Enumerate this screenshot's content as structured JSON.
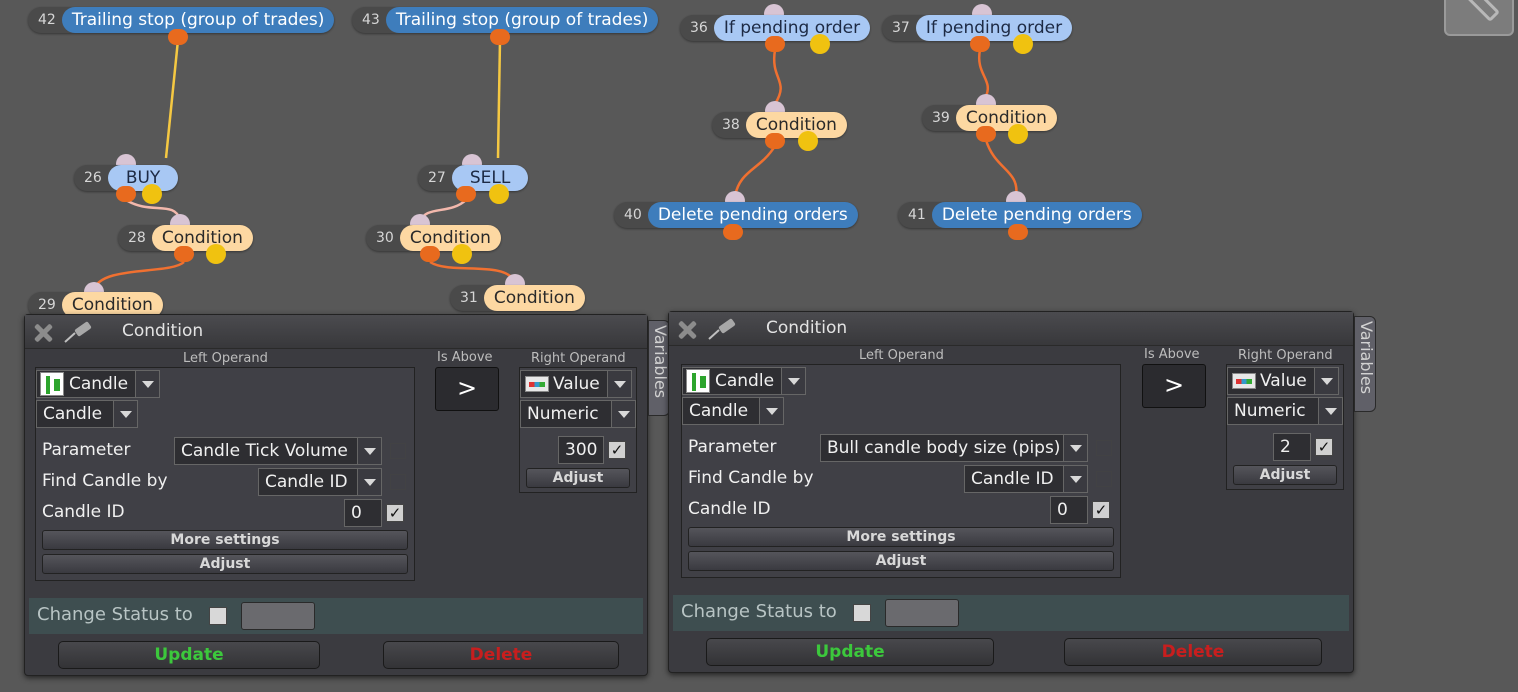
{
  "nodes": [
    {
      "id": "42",
      "label": "Trailing stop (group of trades)"
    },
    {
      "id": "43",
      "label": "Trailing stop (group of trades)"
    },
    {
      "id": "36",
      "label": "If pending order"
    },
    {
      "id": "37",
      "label": "If pending order"
    },
    {
      "id": "38",
      "label": "Condition"
    },
    {
      "id": "39",
      "label": "Condition"
    },
    {
      "id": "26",
      "label": "BUY"
    },
    {
      "id": "27",
      "label": "SELL"
    },
    {
      "id": "40",
      "label": "Delete pending orders"
    },
    {
      "id": "41",
      "label": "Delete pending orders"
    },
    {
      "id": "28",
      "label": "Condition"
    },
    {
      "id": "30",
      "label": "Condition"
    },
    {
      "id": "31",
      "label": "Condition"
    },
    {
      "id": "29",
      "label": "Condition"
    }
  ],
  "panels": [
    {
      "title": "Condition",
      "variables_tab": "Variables",
      "left_operand_label": "Left Operand",
      "is_above_label": "Is Above",
      "right_operand_label": "Right Operand",
      "left_type": "Candle",
      "left_subtype": "Candle",
      "parameter_label": "Parameter",
      "parameter_value": "Candle Tick Volume",
      "find_by_label": "Find Candle by",
      "find_by_value": "Candle ID",
      "candle_id_label": "Candle ID",
      "candle_id_value": "0",
      "more_settings": "More settings",
      "adjust_left": "Adjust",
      "operator": ">",
      "right_type": "Value",
      "right_subtype": "Numeric",
      "right_value": "300",
      "adjust_right": "Adjust",
      "change_status_label": "Change Status to",
      "update": "Update",
      "delete": "Delete"
    },
    {
      "title": "Condition",
      "variables_tab": "Variables",
      "left_operand_label": "Left Operand",
      "is_above_label": "Is Above",
      "right_operand_label": "Right Operand",
      "left_type": "Candle",
      "left_subtype": "Candle",
      "parameter_label": "Parameter",
      "parameter_value": "Bull candle body size (pips)",
      "find_by_label": "Find Candle by",
      "find_by_value": "Candle ID",
      "candle_id_label": "Candle ID",
      "candle_id_value": "0",
      "more_settings": "More settings",
      "adjust_left": "Adjust",
      "operator": ">",
      "right_type": "Value",
      "right_subtype": "Numeric",
      "right_value": "2",
      "adjust_right": "Adjust",
      "change_status_label": "Change Status to",
      "update": "Update",
      "delete": "Delete"
    }
  ],
  "colors": {
    "canvas_bg": "#585858",
    "wire_orange": "#f07030",
    "wire_yellow": "#f5c842",
    "node_blue": "#3e7dbc",
    "node_light_blue": "#a8c8f4",
    "node_condition": "#fdd8a2",
    "update_text": "#3cc83c",
    "delete_text": "#c81e1e"
  }
}
